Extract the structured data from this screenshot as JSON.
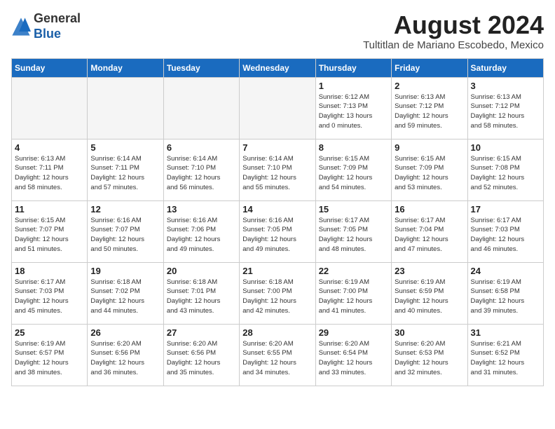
{
  "header": {
    "logo_line1": "General",
    "logo_line2": "Blue",
    "month_title": "August 2024",
    "subtitle": "Tultitlan de Mariano Escobedo, Mexico"
  },
  "weekdays": [
    "Sunday",
    "Monday",
    "Tuesday",
    "Wednesday",
    "Thursday",
    "Friday",
    "Saturday"
  ],
  "weeks": [
    [
      {
        "day": "",
        "empty": true
      },
      {
        "day": "",
        "empty": true
      },
      {
        "day": "",
        "empty": true
      },
      {
        "day": "",
        "empty": true
      },
      {
        "day": "1",
        "sunrise": "6:12 AM",
        "sunset": "7:13 PM",
        "hours": "13 hours",
        "minutes": "0 minutes"
      },
      {
        "day": "2",
        "sunrise": "6:13 AM",
        "sunset": "7:12 PM",
        "hours": "12 hours",
        "minutes": "59 minutes"
      },
      {
        "day": "3",
        "sunrise": "6:13 AM",
        "sunset": "7:12 PM",
        "hours": "12 hours",
        "minutes": "58 minutes"
      }
    ],
    [
      {
        "day": "4",
        "sunrise": "6:13 AM",
        "sunset": "7:11 PM",
        "hours": "12 hours",
        "minutes": "58 minutes"
      },
      {
        "day": "5",
        "sunrise": "6:14 AM",
        "sunset": "7:11 PM",
        "hours": "12 hours",
        "minutes": "57 minutes"
      },
      {
        "day": "6",
        "sunrise": "6:14 AM",
        "sunset": "7:10 PM",
        "hours": "12 hours",
        "minutes": "56 minutes"
      },
      {
        "day": "7",
        "sunrise": "6:14 AM",
        "sunset": "7:10 PM",
        "hours": "12 hours",
        "minutes": "55 minutes"
      },
      {
        "day": "8",
        "sunrise": "6:15 AM",
        "sunset": "7:09 PM",
        "hours": "12 hours",
        "minutes": "54 minutes"
      },
      {
        "day": "9",
        "sunrise": "6:15 AM",
        "sunset": "7:09 PM",
        "hours": "12 hours",
        "minutes": "53 minutes"
      },
      {
        "day": "10",
        "sunrise": "6:15 AM",
        "sunset": "7:08 PM",
        "hours": "12 hours",
        "minutes": "52 minutes"
      }
    ],
    [
      {
        "day": "11",
        "sunrise": "6:15 AM",
        "sunset": "7:07 PM",
        "hours": "12 hours",
        "minutes": "51 minutes"
      },
      {
        "day": "12",
        "sunrise": "6:16 AM",
        "sunset": "7:07 PM",
        "hours": "12 hours",
        "minutes": "50 minutes"
      },
      {
        "day": "13",
        "sunrise": "6:16 AM",
        "sunset": "7:06 PM",
        "hours": "12 hours",
        "minutes": "49 minutes"
      },
      {
        "day": "14",
        "sunrise": "6:16 AM",
        "sunset": "7:05 PM",
        "hours": "12 hours",
        "minutes": "49 minutes"
      },
      {
        "day": "15",
        "sunrise": "6:17 AM",
        "sunset": "7:05 PM",
        "hours": "12 hours",
        "minutes": "48 minutes"
      },
      {
        "day": "16",
        "sunrise": "6:17 AM",
        "sunset": "7:04 PM",
        "hours": "12 hours",
        "minutes": "47 minutes"
      },
      {
        "day": "17",
        "sunrise": "6:17 AM",
        "sunset": "7:03 PM",
        "hours": "12 hours",
        "minutes": "46 minutes"
      }
    ],
    [
      {
        "day": "18",
        "sunrise": "6:17 AM",
        "sunset": "7:03 PM",
        "hours": "12 hours",
        "minutes": "45 minutes"
      },
      {
        "day": "19",
        "sunrise": "6:18 AM",
        "sunset": "7:02 PM",
        "hours": "12 hours",
        "minutes": "44 minutes"
      },
      {
        "day": "20",
        "sunrise": "6:18 AM",
        "sunset": "7:01 PM",
        "hours": "12 hours",
        "minutes": "43 minutes"
      },
      {
        "day": "21",
        "sunrise": "6:18 AM",
        "sunset": "7:00 PM",
        "hours": "12 hours",
        "minutes": "42 minutes"
      },
      {
        "day": "22",
        "sunrise": "6:19 AM",
        "sunset": "7:00 PM",
        "hours": "12 hours",
        "minutes": "41 minutes"
      },
      {
        "day": "23",
        "sunrise": "6:19 AM",
        "sunset": "6:59 PM",
        "hours": "12 hours",
        "minutes": "40 minutes"
      },
      {
        "day": "24",
        "sunrise": "6:19 AM",
        "sunset": "6:58 PM",
        "hours": "12 hours",
        "minutes": "39 minutes"
      }
    ],
    [
      {
        "day": "25",
        "sunrise": "6:19 AM",
        "sunset": "6:57 PM",
        "hours": "12 hours",
        "minutes": "38 minutes"
      },
      {
        "day": "26",
        "sunrise": "6:20 AM",
        "sunset": "6:56 PM",
        "hours": "12 hours",
        "minutes": "36 minutes"
      },
      {
        "day": "27",
        "sunrise": "6:20 AM",
        "sunset": "6:56 PM",
        "hours": "12 hours",
        "minutes": "35 minutes"
      },
      {
        "day": "28",
        "sunrise": "6:20 AM",
        "sunset": "6:55 PM",
        "hours": "12 hours",
        "minutes": "34 minutes"
      },
      {
        "day": "29",
        "sunrise": "6:20 AM",
        "sunset": "6:54 PM",
        "hours": "12 hours",
        "minutes": "33 minutes"
      },
      {
        "day": "30",
        "sunrise": "6:20 AM",
        "sunset": "6:53 PM",
        "hours": "12 hours",
        "minutes": "32 minutes"
      },
      {
        "day": "31",
        "sunrise": "6:21 AM",
        "sunset": "6:52 PM",
        "hours": "12 hours",
        "minutes": "31 minutes"
      }
    ]
  ]
}
